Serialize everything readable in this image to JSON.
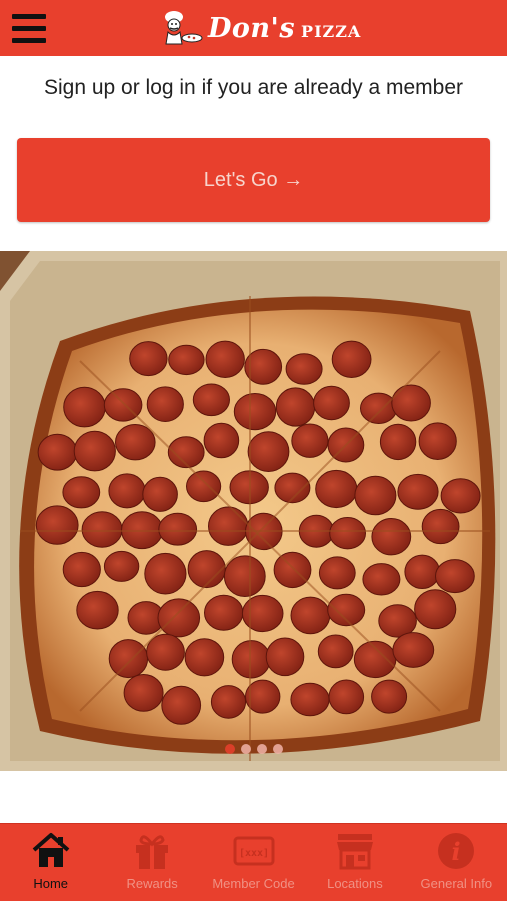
{
  "header": {
    "brand": "Don's",
    "brand_sub": "PIZZA"
  },
  "main": {
    "prompt": "Sign up or log in if you are already a member",
    "cta_label": "Let's Go →",
    "carousel": {
      "slide_count": 4,
      "active_index": 0
    }
  },
  "tabbar": {
    "items": [
      {
        "label": "Home",
        "icon": "home-icon",
        "active": true
      },
      {
        "label": "Rewards",
        "icon": "gift-icon",
        "active": false
      },
      {
        "label": "Member Code",
        "icon": "member-code-icon",
        "active": false
      },
      {
        "label": "Locations",
        "icon": "store-icon",
        "active": false
      },
      {
        "label": "General Info",
        "icon": "info-icon",
        "active": false
      }
    ]
  },
  "colors": {
    "brand_red": "#e8402d",
    "inactive_icon": "#c6301f",
    "active_icon": "#111111"
  }
}
